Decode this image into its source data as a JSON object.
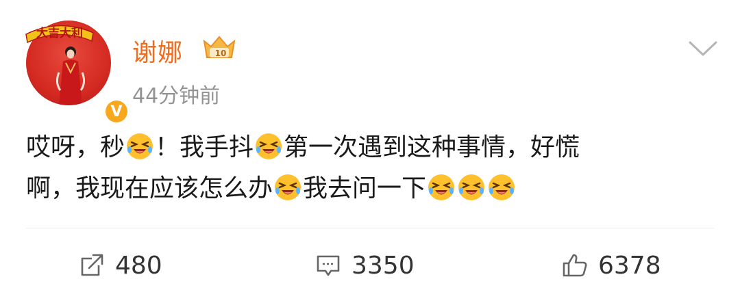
{
  "post": {
    "username": "谢娜",
    "time": "44分钟前",
    "avatar_banner_text": "大吉大利",
    "content_line1_parts": [
      "哎呀，秒",
      "！我手抖",
      "第一次遇到这种事情，好慌"
    ],
    "content_line2_parts": [
      "啊，我现在应该怎么办",
      "我去问一下"
    ],
    "emoji_name": "crying-laugh-emoji"
  },
  "actions": {
    "repost_count": "480",
    "comment_count": "3350",
    "like_count": "6378"
  },
  "colors": {
    "username": "#f06c1e",
    "time": "#939393",
    "text": "#1a1a1a",
    "icon": "#666666",
    "badge_gold": "#f7a81d"
  }
}
